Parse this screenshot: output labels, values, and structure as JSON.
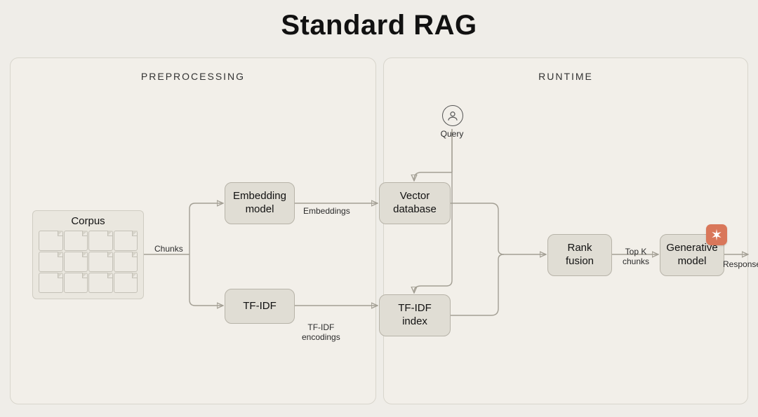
{
  "title": "Standard RAG",
  "sections": {
    "preprocessing": "PREPROCESSING",
    "runtime": "RUNTIME"
  },
  "nodes": {
    "corpus": "Corpus",
    "embedding_model": "Embedding\nmodel",
    "tfidf": "TF-IDF",
    "vector_db": "Vector\ndatabase",
    "tfidf_index": "TF-IDF\nindex",
    "rank_fusion": "Rank\nfusion",
    "generative_model": "Generative\nmodel",
    "query": "Query"
  },
  "edges": {
    "chunks": "Chunks",
    "embeddings": "Embeddings",
    "tfidf_encodings": "TF-IDF\nencodings",
    "top_k": "Top K\nchunks",
    "response": "Response"
  },
  "icons": {
    "user": "user-icon",
    "anthropic": "anthropic-logo-icon"
  }
}
